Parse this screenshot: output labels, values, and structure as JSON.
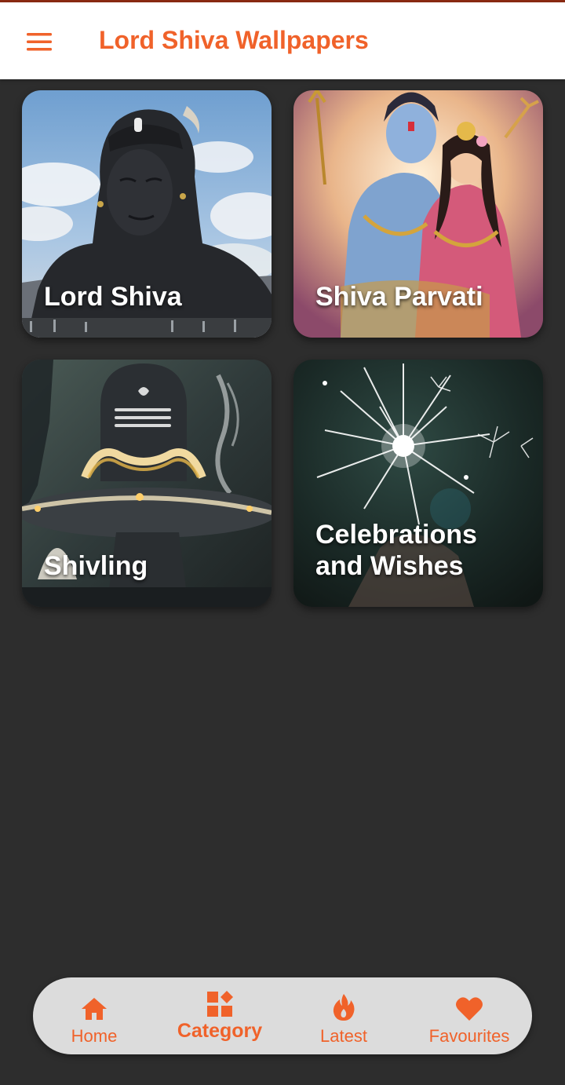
{
  "app": {
    "title": "Lord Shiva Wallpapers",
    "accent_color": "#f0622a",
    "background_color": "#2d2d2d"
  },
  "appbar": {
    "menu_icon": "hamburger-menu-icon"
  },
  "categories": [
    {
      "label": "Lord Shiva",
      "image": "adiyogi-statue-sky"
    },
    {
      "label": "Shiva Parvati",
      "image": "shiva-parvati-painting"
    },
    {
      "label": "Shivling",
      "image": "shivling-with-flower-garland"
    },
    {
      "label": "Celebrations and Wishes",
      "image": "sparkler-fireworks"
    }
  ],
  "bottom_nav": {
    "items": [
      {
        "label": "Home",
        "icon": "home-icon",
        "active": false
      },
      {
        "label": "Category",
        "icon": "category-grid-icon",
        "active": true
      },
      {
        "label": "Latest",
        "icon": "flame-icon",
        "active": false
      },
      {
        "label": "Favourites",
        "icon": "heart-icon",
        "active": false
      }
    ]
  }
}
